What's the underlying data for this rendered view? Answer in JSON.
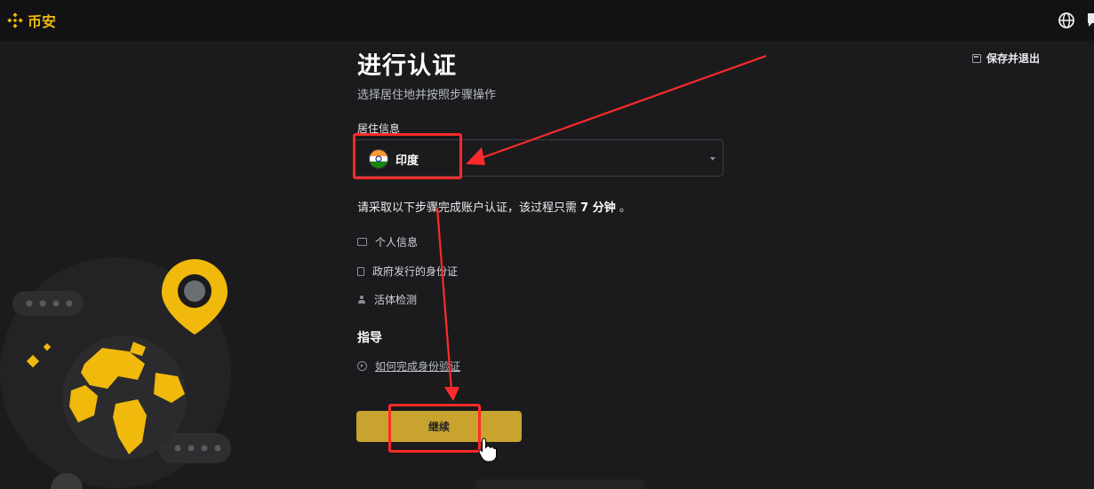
{
  "header": {
    "logo_text": "币安",
    "brand_color": "#F0B90B",
    "globe_icon": "globe-icon",
    "chat_icon": "chat-icon"
  },
  "main": {
    "title": "进行认证",
    "subtitle": "选择居住地并按照步骤操作",
    "save_exit_label": "保存并退出",
    "residence": {
      "label": "居住信息",
      "selected_value": "印度"
    },
    "steps_intro_prefix": "请采取以下步骤完成账户认证，该过程只需 ",
    "steps_intro_time": "7 分钟",
    "steps_intro_suffix": " 。",
    "steps": [
      {
        "label": "个人信息",
        "icon": "id-card-icon"
      },
      {
        "label": "政府发行的身份证",
        "icon": "document-icon"
      },
      {
        "label": "活体检测",
        "icon": "person-icon"
      }
    ],
    "guide_heading": "指导",
    "guide_link": "如何完成身份验证",
    "continue_label": "继续"
  },
  "colors": {
    "background": "#1b1b1d",
    "button": "#C8A42E",
    "annotation": "#FF2A2A"
  }
}
